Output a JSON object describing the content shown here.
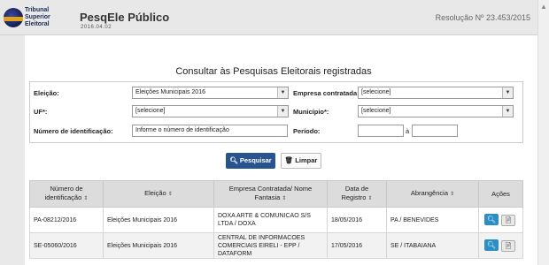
{
  "header": {
    "logo_line1": "Tribunal",
    "logo_line2": "Superior",
    "logo_line3": "Eleitoral",
    "title": "PesqEle Público",
    "date": "2016.04.02",
    "resolution": "Resolução Nº 23.453/2015"
  },
  "page_title": "Consultar às Pesquisas Eleitorais registradas",
  "form": {
    "eleicao_label": "Eleição:",
    "eleicao_value": "Eleições Municipais 2016",
    "empresa_label": "Empresa contratada:",
    "empresa_value": "[selecione]",
    "uf_label": "UF*:",
    "uf_value": "[selecione]",
    "municipio_label": "Município*:",
    "municipio_value": "[selecione]",
    "numero_label": "Número de identificação:",
    "numero_placeholder": "Informe o número de identificação",
    "periodo_label": "Período:",
    "periodo_sep": "à"
  },
  "buttons": {
    "search": "Pesquisar",
    "clear": "Limpar"
  },
  "table": {
    "headers": {
      "numero_1": "Número de",
      "numero_2": "identificação",
      "eleicao": "Eleição",
      "empresa_1": "Empresa Contratada/ Nome",
      "empresa_2": "Fantasia",
      "data_1": "Data de",
      "data_2": "Registro",
      "abrangencia": "Abrangência",
      "acoes": "Ações"
    },
    "rows": [
      {
        "numero": "PA-08212/2016",
        "eleicao": "Eleições Municipais 2016",
        "empresa_1": "DOXA ARTE & COMUNICAO S/S",
        "empresa_2": "LTDA / DOXA",
        "empresa_3": "",
        "data": "18/05/2016",
        "abrangencia": "PA / BENEVIDES"
      },
      {
        "numero": "SE-05060/2016",
        "eleicao": "Eleições Municipais 2016",
        "empresa_1": "CENTRAL DE INFORMACOES",
        "empresa_2": "COMERCIAIS EIRELI - EPP /",
        "empresa_3": "DATAFORM",
        "data": "17/05/2016",
        "abrangencia": "SE / ITABAIANA"
      }
    ]
  },
  "icons": {
    "sort": "sort-icon",
    "search": "search-icon",
    "trash": "trash-icon",
    "doc": "document-icon"
  },
  "colors": {
    "primary_button": "#27548f",
    "view_button": "#2b8fc6"
  }
}
